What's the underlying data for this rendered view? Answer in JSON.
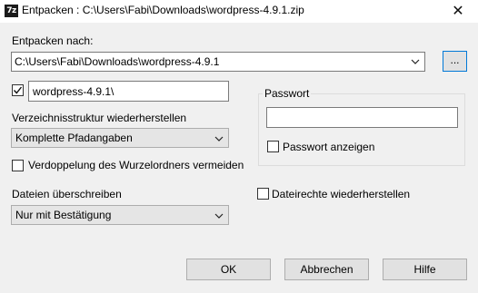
{
  "window": {
    "app_icon_text": "7z",
    "title": "Entpacken : C:\\Users\\Fabi\\Downloads\\wordpress-4.9.1.zip",
    "close_glyph": "✕"
  },
  "extract": {
    "label": "Entpacken nach:",
    "path_value": "C:\\Users\\Fabi\\Downloads\\wordpress-4.9.1",
    "browse_label": "...",
    "subfolder_checked": true,
    "subfolder_value": "wordpress-4.9.1\\"
  },
  "path_mode": {
    "label": "Verzeichnisstruktur wiederherstellen",
    "selected": "Komplette Pfadangaben"
  },
  "eliminate_duplication": {
    "label": "Verdoppelung des Wurzelordners vermeiden",
    "checked": false
  },
  "overwrite": {
    "label": "Dateien überschreiben",
    "selected": "Nur mit Bestätigung"
  },
  "password": {
    "group_label": "Passwort",
    "value": "",
    "show_label": "Passwort anzeigen",
    "show_checked": false
  },
  "restore_security": {
    "label": "Dateirechte wiederherstellen",
    "checked": false
  },
  "buttons": {
    "ok": "OK",
    "cancel": "Abbrechen",
    "help": "Hilfe"
  }
}
